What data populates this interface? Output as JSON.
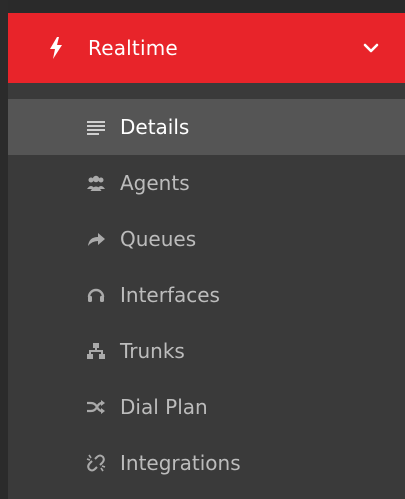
{
  "section": {
    "title": "Realtime",
    "icon": "bolt-icon",
    "expanded_icon": "chevron-down-icon",
    "color": "#e8242a"
  },
  "submenu": {
    "items": [
      {
        "label": "Details",
        "icon": "list-lines-icon",
        "active": true
      },
      {
        "label": "Agents",
        "icon": "users-icon",
        "active": false
      },
      {
        "label": "Queues",
        "icon": "share-arrow-icon",
        "active": false
      },
      {
        "label": "Interfaces",
        "icon": "headset-icon",
        "active": false
      },
      {
        "label": "Trunks",
        "icon": "sitemap-icon",
        "active": false
      },
      {
        "label": "Dial Plan",
        "icon": "random-icon",
        "active": false
      },
      {
        "label": "Integrations",
        "icon": "unlink-icon",
        "active": false
      }
    ]
  }
}
